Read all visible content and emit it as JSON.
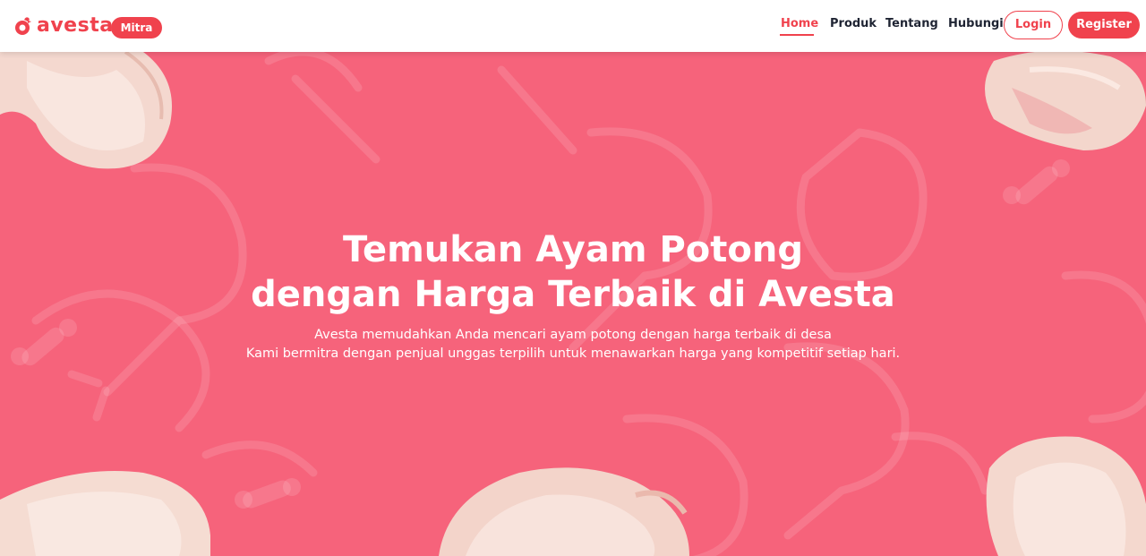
{
  "brand": {
    "name": "avesta",
    "badge": "Mitra",
    "color": "#f0424d"
  },
  "nav": {
    "items": [
      {
        "label": "Home",
        "active": true
      },
      {
        "label": "Produk",
        "active": false
      },
      {
        "label": "Tentang",
        "active": false
      },
      {
        "label": "Hubungi",
        "active": false
      }
    ],
    "login_label": "Login",
    "register_label": "Register"
  },
  "hero": {
    "background": "#f6637b",
    "title_lines": [
      "Temukan Ayam Potong",
      "dengan Harga Terbaik di Avesta"
    ],
    "subtitle_lines": [
      "Avesta memudahkan Anda mencari ayam potong dengan harga terbaik di desa",
      "Kami bermitra dengan penjual unggas terpilih untuk menawarkan harga yang kompetitif setiap hari."
    ],
    "images": [
      "raw-chicken-drumstick-image",
      "raw-chicken-thigh-image",
      "raw-whole-chicken-image"
    ]
  }
}
